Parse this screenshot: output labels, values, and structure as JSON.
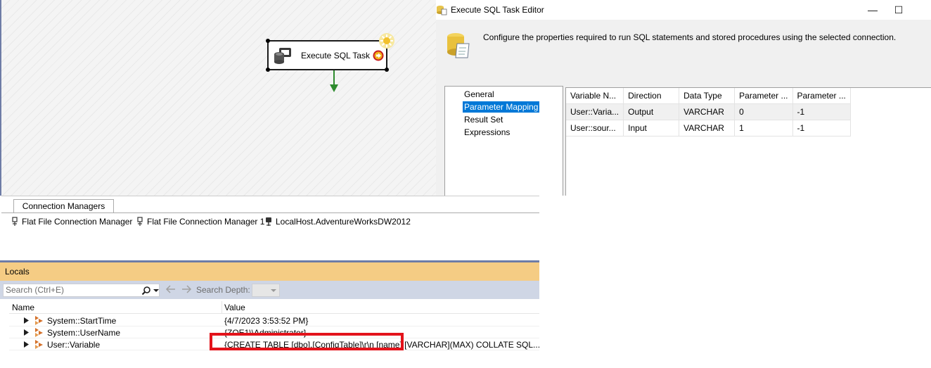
{
  "designer": {
    "task_label": "Execute SQL Task"
  },
  "dialog": {
    "title": "Execute SQL Task Editor",
    "minimize_glyph": "—",
    "maximize_glyph": "☐",
    "description": "Configure the properties required to run SQL statements and stored procedures using the selected connection.",
    "nav_items": [
      "General",
      "Parameter Mapping",
      "Result Set",
      "Expressions"
    ],
    "selected_nav": "Parameter Mapping",
    "grid": {
      "columns": [
        "Variable N...",
        "Direction",
        "Data Type",
        "Parameter ...",
        "Parameter ..."
      ],
      "rows": [
        [
          "User::Varia...",
          "Output",
          "VARCHAR",
          "0",
          "-1"
        ],
        [
          "User::sour...",
          "Input",
          "VARCHAR",
          "1",
          "-1"
        ]
      ]
    }
  },
  "connections": {
    "tab_label": "Connection Managers",
    "items": [
      "Flat File Connection Manager",
      "Flat File Connection Manager 1",
      "LocalHost.AdventureWorksDW2012"
    ]
  },
  "locals": {
    "title": "Locals",
    "search_placeholder": "Search (Ctrl+E)",
    "search_depth_label": "Search Depth:",
    "col_name": "Name",
    "col_value": "Value",
    "rows": [
      {
        "name": "System::StartTime",
        "value": "{4/7/2023 3:53:52 PM}"
      },
      {
        "name": "System::UserName",
        "value": "{ZOE1\\\\Administrator}"
      },
      {
        "name": "User::Variable",
        "value": "{CREATE TABLE [dbo].[ConfigTable]\\r\\n      [name] [VARCHAR](MAX) COLLATE SQL..."
      }
    ]
  },
  "colors": {
    "accent_blue": "#0078d7",
    "locals_title_bg": "#f5cc84",
    "highlight_red": "#e3131b",
    "arrow_green": "#2e8b2e"
  }
}
